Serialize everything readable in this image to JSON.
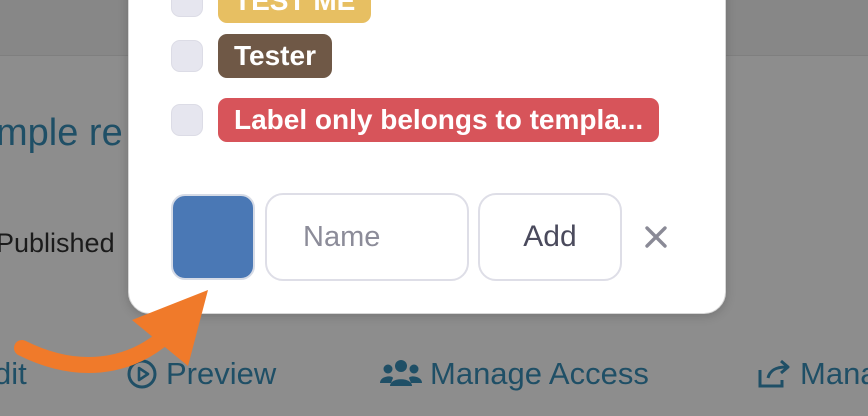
{
  "background": {
    "title_fragment": "mple re",
    "status_fragment": "Published",
    "actions": [
      {
        "label": "dit",
        "icon": "edit-icon"
      },
      {
        "label": "Preview",
        "icon": "play-circle-icon"
      },
      {
        "label": "Manage Access",
        "icon": "users-icon"
      },
      {
        "label": "Mana",
        "icon": "share-icon"
      }
    ]
  },
  "labels_popover": {
    "labels": [
      {
        "text": "TEST ME",
        "color": "#e7bf62",
        "checked": false
      },
      {
        "text": "Tester",
        "color": "#6f5846",
        "checked": false
      },
      {
        "text": "Label only belongs to templa...",
        "color": "#d7545a",
        "checked": false
      }
    ],
    "new_label": {
      "color": "#4a78b5",
      "name_placeholder": "Name",
      "name_value": "",
      "add_label": "Add",
      "close_icon": "close-icon"
    }
  },
  "annotation": {
    "arrow_color": "#f07a2a",
    "arrow_icon": "curved-arrow-icon"
  }
}
